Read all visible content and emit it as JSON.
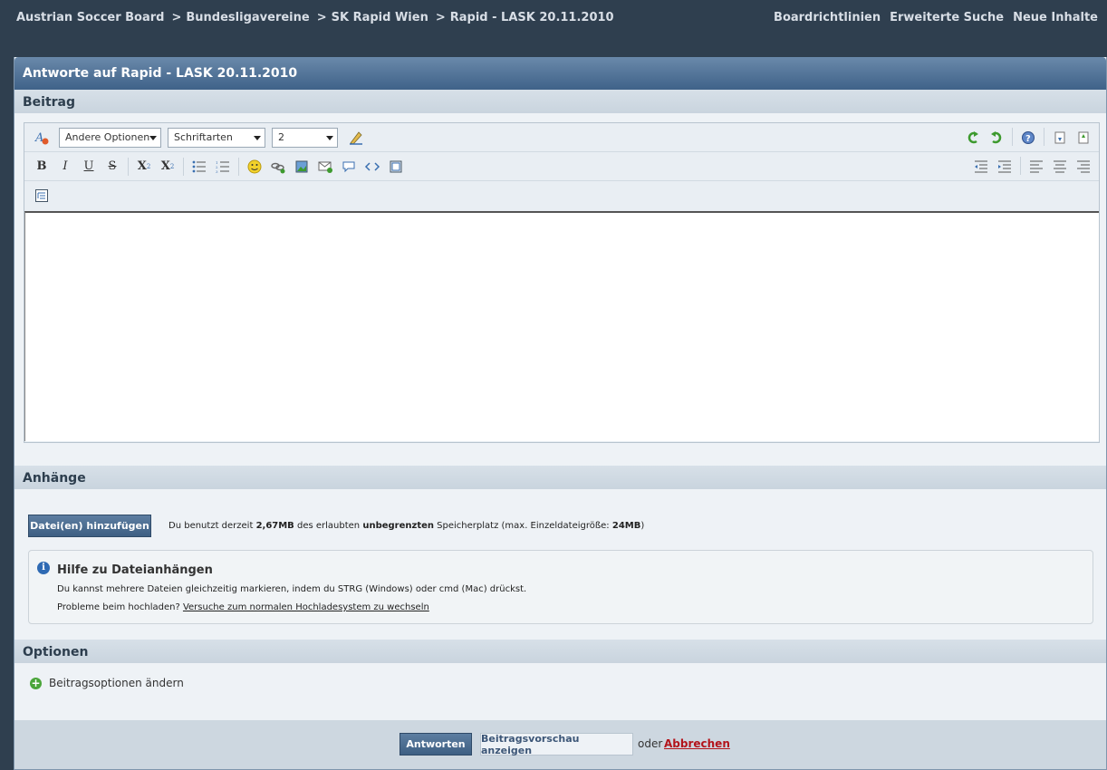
{
  "breadcrumb": {
    "items": [
      "Austrian Soccer Board",
      "Bundesligavereine",
      "SK Rapid Wien",
      "Rapid - LASK 20.11.2010"
    ],
    "separator": ">"
  },
  "toplinks": [
    "Boardrichtlinien",
    "Erweiterte Suche",
    "Neue Inhalte"
  ],
  "panel": {
    "title": "Antworte auf Rapid - LASK 20.11.2010"
  },
  "sections": {
    "beitrag": "Beitrag",
    "anhaenge": "Anhänge",
    "optionen": "Optionen"
  },
  "toolbar": {
    "dropdown_options": "Andere Optionen",
    "dropdown_font": "Schriftarten",
    "dropdown_size": "2",
    "bold": "B",
    "italic": "I",
    "underline": "U",
    "strike": "S",
    "sub": "X",
    "sup": "X"
  },
  "attachments": {
    "button_label": "Datei(en) hinzufügen",
    "info_prefix": "Du benutzt derzeit ",
    "info_used": "2,67MB",
    "info_mid": " des erlaubten ",
    "info_quota": "unbegrenzten",
    "info_suffix": " Speicherplatz (max. Einzeldateigröße: ",
    "info_max": "24MB",
    "info_end": ")"
  },
  "help": {
    "title": "Hilfe zu Dateianhängen",
    "line1": "Du kannst mehrere Dateien gleichzeitig markieren, indem du STRG (Windows) oder cmd (Mac) drückst.",
    "line2_prefix": "Probleme beim hochladen? ",
    "line2_link": "Versuche zum normalen Hochladesystem zu wechseln"
  },
  "options": {
    "change_label": "Beitragsoptionen ändern"
  },
  "footer": {
    "submit": "Antworten",
    "preview": "Beitragsvorschau anzeigen",
    "or": "oder",
    "cancel": "Abbrechen"
  },
  "colors": {
    "background": "#2f3f4f",
    "accent": "#3e5f83",
    "cancel": "#b3141b",
    "plus": "#4aa53a"
  }
}
